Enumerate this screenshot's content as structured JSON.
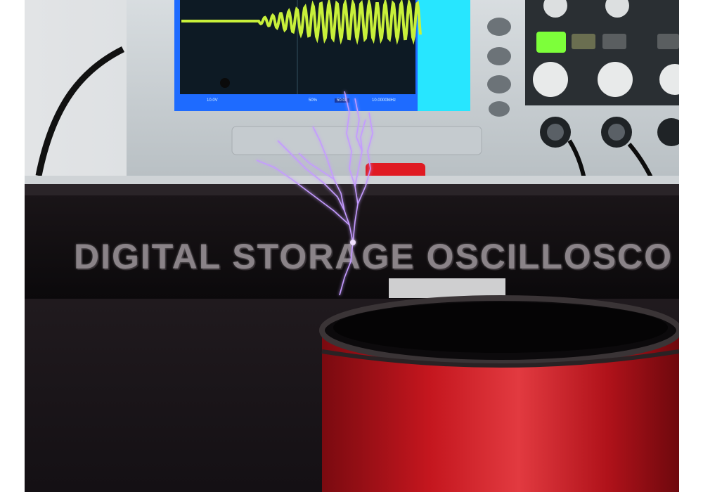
{
  "scene": {
    "box_print": "DIGITAL STORAGE OSCILLOSCO",
    "colors": {
      "waveform": "#c8f03a",
      "scope_screen_edge": "#1e6bff",
      "scope_panel": "#27e6ff",
      "spark": "#b88bff",
      "coil": "#b5121a",
      "button_lit": "#7dff3a"
    },
    "status": {
      "left": "10.0V",
      "mid": "50%",
      "sel": "50.0k",
      "right": "10.0000MHz"
    }
  }
}
